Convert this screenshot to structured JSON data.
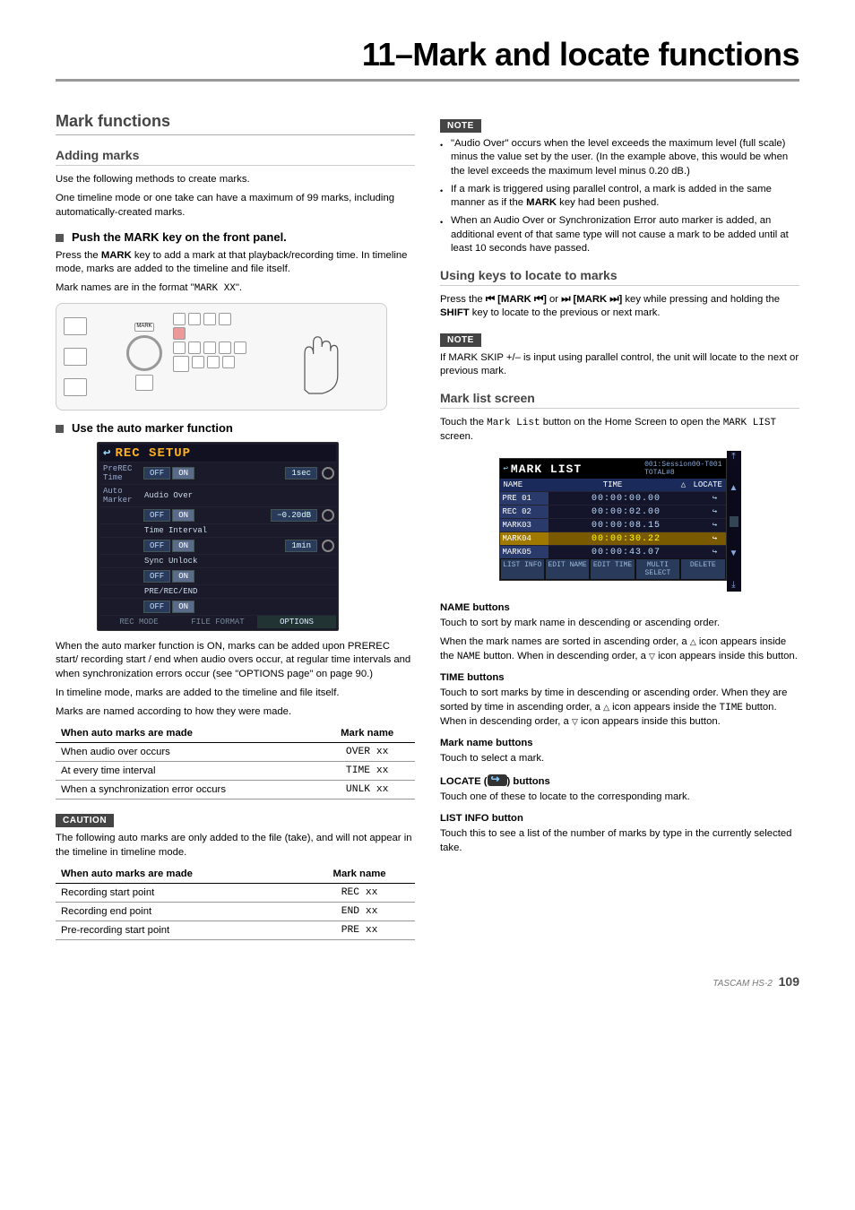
{
  "chapterTitle": "11–Mark and locate functions",
  "left": {
    "h2": "Mark functions",
    "h3a": "Adding marks",
    "p1": "Use the following methods to create marks.",
    "p2": "One timeline mode or one take can have a maximum of 99 marks, including automatically-created marks.",
    "sub1": "Push the MARK key on the front panel.",
    "p3a": "Press the ",
    "p3b": " key to add a mark at that playback/recording time. In timeline mode, marks are added to the timeline and file itself.",
    "p4a": "Mark names are in the format \"",
    "p4code": "MARK XX",
    "p4b": "\".",
    "sub2": "Use the auto marker function",
    "lcd": {
      "title": "REC SETUP",
      "r1lab": "PreREC Time",
      "r1off": "OFF",
      "r1on": "ON",
      "r1val": "1sec",
      "r2lab": "Auto Marker",
      "r2sub": "Audio Over",
      "r2off": "OFF",
      "r2on": "ON",
      "r2val": "−0.20dB",
      "r3sub": "Time Interval",
      "r3off": "OFF",
      "r3on": "ON",
      "r3val": "1min",
      "r4sub": "Sync Unlock",
      "r4off": "OFF",
      "r4on": "ON",
      "r5sub": "PRE/REC/END",
      "r5off": "OFF",
      "r5on": "ON",
      "tab1": "REC MODE",
      "tab2": "FILE FORMAT",
      "tab3": "OPTIONS"
    },
    "p5": "When the auto marker function is ON, marks can be added upon PREREC start/ recording start / end when audio overs occur, at regular time intervals and when synchronization errors occur (see \"OPTIONS page\" on page 90.)",
    "p6": "In timeline mode, marks are added to the timeline and file itself.",
    "p7": "Marks are named according to how they were made.",
    "table1": {
      "h1": "When auto marks are made",
      "h2": "Mark name",
      "rows": [
        {
          "a": "When audio over occurs",
          "b": "OVER xx"
        },
        {
          "a": "At every time interval",
          "b": "TIME xx"
        },
        {
          "a": "When a synchronization error occurs",
          "b": "UNLK xx"
        }
      ]
    },
    "caution": "CAUTION",
    "p8": "The following auto marks are only added to the file (take), and will not appear in the timeline in timeline mode.",
    "table2": {
      "h1": "When auto marks are made",
      "h2": "Mark name",
      "rows": [
        {
          "a": "Recording start point",
          "b": "REC xx"
        },
        {
          "a": "Recording end point",
          "b": "END xx"
        },
        {
          "a": "Pre-recording start point",
          "b": "PRE xx"
        }
      ]
    }
  },
  "right": {
    "note": "NOTE",
    "b1": "\"Audio Over\" occurs when the level exceeds the maximum level (full scale) minus the value set by the user. (In the example above, this would be when the level exceeds the maximum level minus 0.20 dB.)",
    "b2a": "If a mark is triggered using parallel control, a mark is added in the same manner as if the ",
    "b2b": " key had been pushed.",
    "b3": "When an Audio Over or Synchronization Error auto marker is added, an additional event of that same type will not cause a mark to be added until at least 10 seconds have passed.",
    "h3a": "Using keys to locate to marks",
    "p1a": "Press the ",
    "p1b": " or ",
    "p1c": " key while pressing and holding the ",
    "p1d": " key to locate to the previous or next mark.",
    "note2": "NOTE",
    "p2": "If MARK SKIP +/– is input using parallel control, the unit will locate to the next or previous mark.",
    "h3b": "Mark list screen",
    "p3a": "Touch the ",
    "p3code": "Mark List",
    "p3b": " button on the Home Screen to open the ",
    "p3code2": "MARK LIST",
    "p3c": " screen.",
    "marklist": {
      "title": "MARK LIST",
      "sub": "001:Session00-T001",
      "total": "TOTAL#8",
      "colName": "NAME",
      "colTime": "TIME",
      "colLocate": "LOCATE",
      "rows": [
        {
          "n": "PRE 01",
          "t": "00:00:00.00",
          "sel": false
        },
        {
          "n": "REC 02",
          "t": "00:00:02.00",
          "sel": false
        },
        {
          "n": "MARK03",
          "t": "00:00:08.15",
          "sel": false
        },
        {
          "n": "MARK04",
          "t": "00:00:30.22",
          "sel": true
        },
        {
          "n": "MARK05",
          "t": "00:00:43.07",
          "sel": false
        }
      ],
      "btns": [
        "LIST INFO",
        "EDIT NAME",
        "EDIT TIME",
        "MULTI SELECT",
        "DELETE"
      ]
    },
    "nb1": "NAME buttons",
    "p4": "Touch to sort by mark name in descending or ascending order.",
    "p5a": "When the mark names are sorted in ascending order, a ",
    "p5b": " icon appears inside the ",
    "p5code": "NAME",
    "p5c": " button. When in descending order, a ",
    "p5d": " icon appears inside this button.",
    "nb2": "TIME buttons",
    "p6a": "Touch to sort marks by time in descending or ascending order. When they are sorted by time in ascending order, a ",
    "p6b": " icon appears inside the ",
    "p6code": "TIME",
    "p6c": " button. When in descending order, a ",
    "p6d": " icon appears inside this button.",
    "nb3": "Mark name buttons",
    "p7": "Touch to select a mark.",
    "nb4a": "LOCATE (",
    "nb4b": ") buttons",
    "p8": "Touch one of these to locate to the corresponding mark.",
    "nb5": "LIST INFO button",
    "p9": "Touch this to see a list of the number of marks by type in the currently selected take."
  },
  "footer": {
    "model": "TASCAM HS-2",
    "page": "109"
  }
}
